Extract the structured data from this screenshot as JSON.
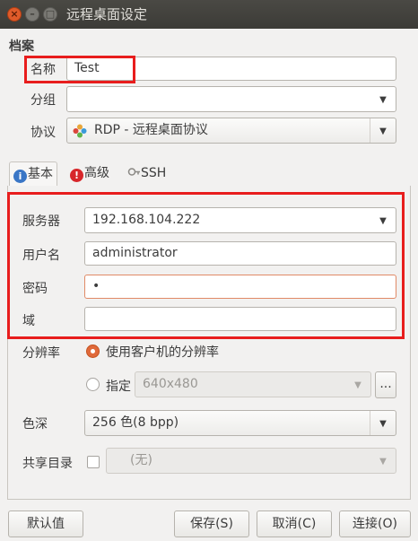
{
  "window": {
    "title": "远程桌面设定"
  },
  "profile": {
    "section": "档案",
    "name_label": "名称",
    "name_value": "Test",
    "group_label": "分组",
    "group_value": "",
    "protocol_label": "协议",
    "protocol_value": "RDP - 远程桌面协议"
  },
  "tabs": [
    {
      "label": "基本",
      "icon": "info-icon",
      "active": true
    },
    {
      "label": "高级",
      "icon": "warning-icon",
      "active": false
    },
    {
      "label": "SSH",
      "icon": "ssh-key-icon",
      "active": false
    }
  ],
  "basic": {
    "server_label": "服务器",
    "server_value": "192.168.104.222",
    "username_label": "用户名",
    "username_value": "administrator",
    "password_label": "密码",
    "password_value": "•",
    "domain_label": "域",
    "domain_value": "",
    "resolution_label": "分辨率",
    "resolution_option_client": "使用客户机的分辨率",
    "resolution_option_custom": "指定",
    "resolution_custom_value": "640x480",
    "more_button": "...",
    "color_label": "色深",
    "color_value": "256 色(8 bpp)",
    "share_label": "共享目录",
    "share_value": "(无)"
  },
  "buttons": {
    "default": "默认值",
    "save": "保存(S)",
    "cancel": "取消(C)",
    "connect": "连接(O)"
  },
  "colors": {
    "highlight": "#e81d1d",
    "radio_selected": "#e0693a",
    "titlebar": "#3c3b37"
  }
}
